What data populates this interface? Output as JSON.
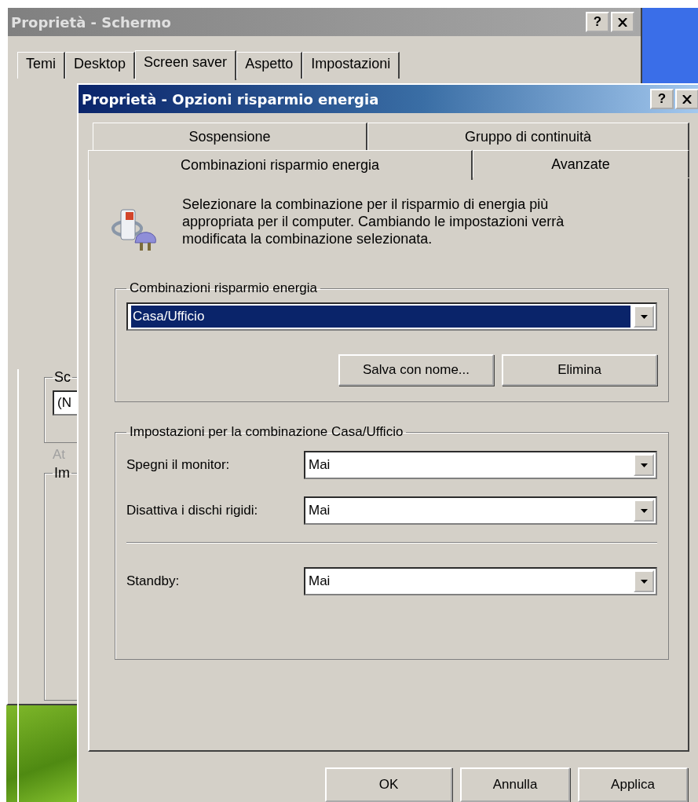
{
  "back_window": {
    "title": "Proprietà - Schermo",
    "help_button": "?",
    "tabs": [
      {
        "label": "Temi",
        "selected": false
      },
      {
        "label": "Desktop",
        "selected": false
      },
      {
        "label": "Screen saver",
        "selected": true
      },
      {
        "label": "Aspetto",
        "selected": false
      },
      {
        "label": "Impostazioni",
        "selected": false
      }
    ],
    "screen_saver_group": {
      "label": "Sc",
      "field_value": "(N",
      "hint": "At",
      "hint_disabled": true
    },
    "energy_group": {
      "label": "Im"
    }
  },
  "dialog": {
    "title": "Proprietà - Opzioni risparmio energia",
    "help_button": "?",
    "tab_rows": [
      [
        {
          "label": "Sospensione",
          "selected": false
        },
        {
          "label": "Gruppo di continuità",
          "selected": false
        }
      ],
      [
        {
          "label": "Combinazioni risparmio energia",
          "selected": true
        },
        {
          "label": "Avanzate",
          "selected": false
        }
      ]
    ],
    "description": "Selezionare la combinazione per il risparmio di energia più appropriata per il computer. Cambiando le impostazioni verrà modificata la combinazione selezionata.",
    "schemes_group": {
      "label": "Combinazioni risparmio energia",
      "selected_scheme": "Casa/Ufficio",
      "buttons": [
        "Salva con nome...",
        "Elimina"
      ]
    },
    "settings_group": {
      "label": "Impostazioni per la combinazione Casa/Ufficio",
      "rows": [
        {
          "label": "Spegni il monitor:",
          "value": "Mai",
          "separator_before": false
        },
        {
          "label": "Disattiva i dischi rigidi:",
          "value": "Mai",
          "separator_before": false
        },
        {
          "label": "Standby:",
          "value": "Mai",
          "separator_before": true
        }
      ]
    },
    "buttons": [
      "OK",
      "Annulla",
      "Applica"
    ]
  }
}
